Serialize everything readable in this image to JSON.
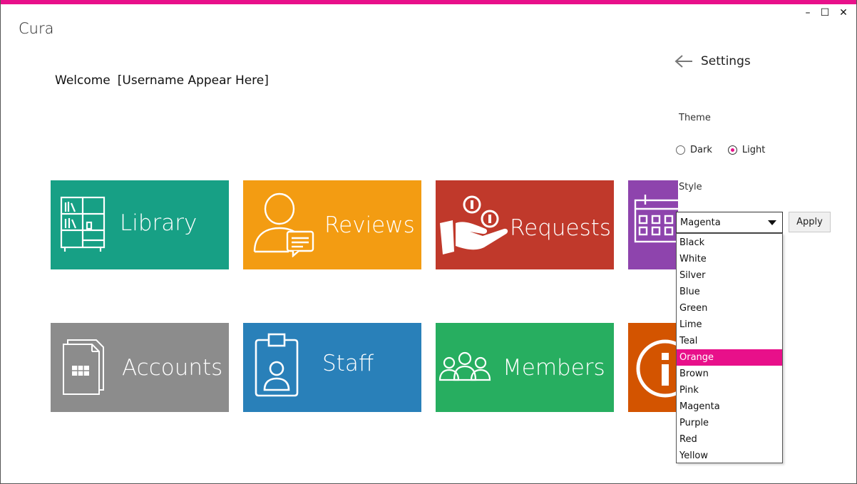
{
  "window": {
    "title": "Cura",
    "accent_color": "#e8108a",
    "controls": {
      "minimize": "–",
      "maximize": "☐",
      "close": "✕"
    }
  },
  "welcome": {
    "greeting": "Welcome",
    "username": "[Username Appear Here]"
  },
  "tiles": [
    {
      "label": "Library",
      "icon": "bookshelf-icon",
      "color": "#17a085"
    },
    {
      "label": "Reviews",
      "icon": "user-comment-icon",
      "color": "#f39c12"
    },
    {
      "label": "Requests",
      "icon": "hand-coins-icon",
      "color": "#c0392b"
    },
    {
      "label": "",
      "icon": "calendar-icon",
      "color": "#8e44ad"
    },
    {
      "label": "Accounts",
      "icon": "spreadsheet-document-icon",
      "color": "#8c8c8c"
    },
    {
      "label": "Staff",
      "icon": "id-badge-icon",
      "color": "#2980b9"
    },
    {
      "label": "Members",
      "icon": "group-icon",
      "color": "#27ae60"
    },
    {
      "label": "",
      "icon": "info-icon",
      "color": "#d35400"
    }
  ],
  "settings": {
    "title": "Settings",
    "back_icon": "arrow-left-icon",
    "theme_label": "Theme",
    "theme_options": [
      {
        "label": "Dark",
        "checked": false
      },
      {
        "label": "Light",
        "checked": true
      }
    ],
    "style_label": "Style",
    "style_selected": "Magenta",
    "apply_label": "Apply",
    "style_options": [
      "Black",
      "White",
      "Silver",
      "Blue",
      "Green",
      "Lime",
      "Teal",
      "Orange",
      "Brown",
      "Pink",
      "Magenta",
      "Purple",
      "Red",
      "Yellow"
    ],
    "highlighted_option": "Orange"
  }
}
